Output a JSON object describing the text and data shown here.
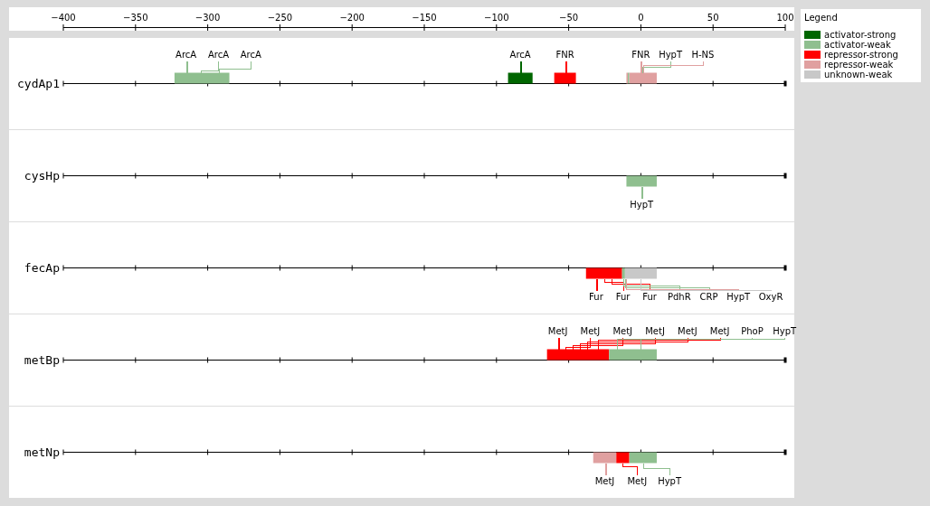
{
  "axis": {
    "ticks": [
      "−400",
      "−350",
      "−300",
      "−250",
      "−200",
      "−150",
      "−100",
      "−50",
      "0",
      "50",
      "100"
    ]
  },
  "rows": [
    {
      "name": "cydAp1",
      "kind": "above",
      "sites": [
        {
          "label": "ArcA",
          "color": "#8fbf8f"
        },
        {
          "label": "ArcA",
          "color": "#8fbf8f"
        },
        {
          "label": "ArcA",
          "color": "#8fbf8f"
        },
        {
          "label": "ArcA",
          "color": "#006600"
        },
        {
          "label": "FNR",
          "color": "#ff0000"
        },
        {
          "label": "FNR",
          "color": "#e0a0a0"
        },
        {
          "label": "HypT",
          "color": "#8fbf8f"
        },
        {
          "label": "H-NS",
          "color": "#e0a0a0"
        }
      ]
    },
    {
      "name": "cysHp",
      "kind": "below",
      "sites": [
        {
          "label": "HypT",
          "color": "#8fbf8f"
        }
      ]
    },
    {
      "name": "fecAp",
      "kind": "below",
      "sites": [
        {
          "label": "Fur",
          "color": "#ff0000"
        },
        {
          "label": "Fur",
          "color": "#ff0000"
        },
        {
          "label": "Fur",
          "color": "#ff0000"
        },
        {
          "label": "PdhR",
          "color": "#8fbf8f"
        },
        {
          "label": "CRP",
          "color": "#8fbf8f"
        },
        {
          "label": "HypT",
          "color": "#e0a0a0"
        },
        {
          "label": "OxyR",
          "color": "#c8c8c8"
        }
      ]
    },
    {
      "name": "metBp",
      "kind": "above",
      "sites": [
        {
          "label": "MetJ",
          "color": "#ff0000"
        },
        {
          "label": "MetJ",
          "color": "#ff0000"
        },
        {
          "label": "MetJ",
          "color": "#ff0000"
        },
        {
          "label": "MetJ",
          "color": "#ff0000"
        },
        {
          "label": "MetJ",
          "color": "#ff0000"
        },
        {
          "label": "MetJ",
          "color": "#ff0000"
        },
        {
          "label": "PhoP",
          "color": "#8fbf8f"
        },
        {
          "label": "HypT",
          "color": "#8fbf8f"
        }
      ]
    },
    {
      "name": "metNp",
      "kind": "below",
      "sites": [
        {
          "label": "MetJ",
          "color": "#e0a0a0"
        },
        {
          "label": "MetJ",
          "color": "#ff0000"
        },
        {
          "label": "HypT",
          "color": "#8fbf8f"
        }
      ]
    }
  ],
  "legend": {
    "title": "Legend",
    "items": [
      {
        "label": "activator-strong",
        "color": "#006600"
      },
      {
        "label": "activator-weak",
        "color": "#8fbf8f"
      },
      {
        "label": "repressor-strong",
        "color": "#ff0000"
      },
      {
        "label": "repressor-weak",
        "color": "#e0a0a0"
      },
      {
        "label": "unknown-weak",
        "color": "#c8c8c8"
      }
    ]
  }
}
